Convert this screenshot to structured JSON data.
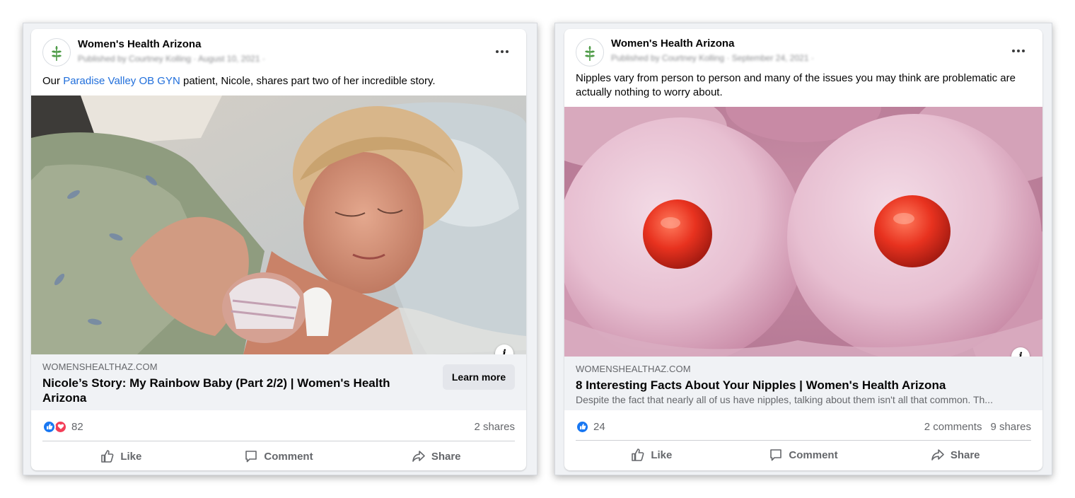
{
  "posts": [
    {
      "page_name": "Women's Health Arizona",
      "byline": "Published by Courtney Kolling · August 10, 2021 ·",
      "text_before": "Our ",
      "text_link": "Paradise Valley OB GYN",
      "text_after": " patient, Nicole, shares part two of her incredible story.",
      "image_alt": "mother-holding-newborn-photo",
      "link_domain": "WOMENSHEALTHAZ.COM",
      "link_title": "Nicole’s Story: My Rainbow Baby (Part 2/2) | Women's Health Arizona",
      "cta_label": "Learn more",
      "reaction_count": "82",
      "reactions": [
        "like-icon",
        "love-icon"
      ],
      "shares": "2 shares",
      "actions": {
        "like": "Like",
        "comment": "Comment",
        "share": "Share"
      }
    },
    {
      "page_name": "Women's Health Arizona",
      "byline": "Published by Courtney Kolling · September 24, 2021 ·",
      "text": "Nipples vary from person to person and many of the issues you may think are problematic are actually nothing to worry about.",
      "image_alt": "pink-ice-cream-scoops-photo",
      "link_domain": "WOMENSHEALTHAZ.COM",
      "link_title": "8 Interesting Facts About Your Nipples | Women's Health Arizona",
      "link_desc": "Despite the fact that nearly all of us have nipples, talking about them isn't all that common. Th...",
      "reaction_count": "24",
      "reactions": [
        "like-icon"
      ],
      "comments": "2 comments",
      "shares": "9 shares",
      "actions": {
        "like": "Like",
        "comment": "Comment",
        "share": "Share"
      }
    }
  ],
  "colors": {
    "link": "#216fdb",
    "like_blue": "#1877f2",
    "love_red": "#f33e58",
    "secondary_text": "#65676b",
    "brand_green": "#4e9b47"
  }
}
